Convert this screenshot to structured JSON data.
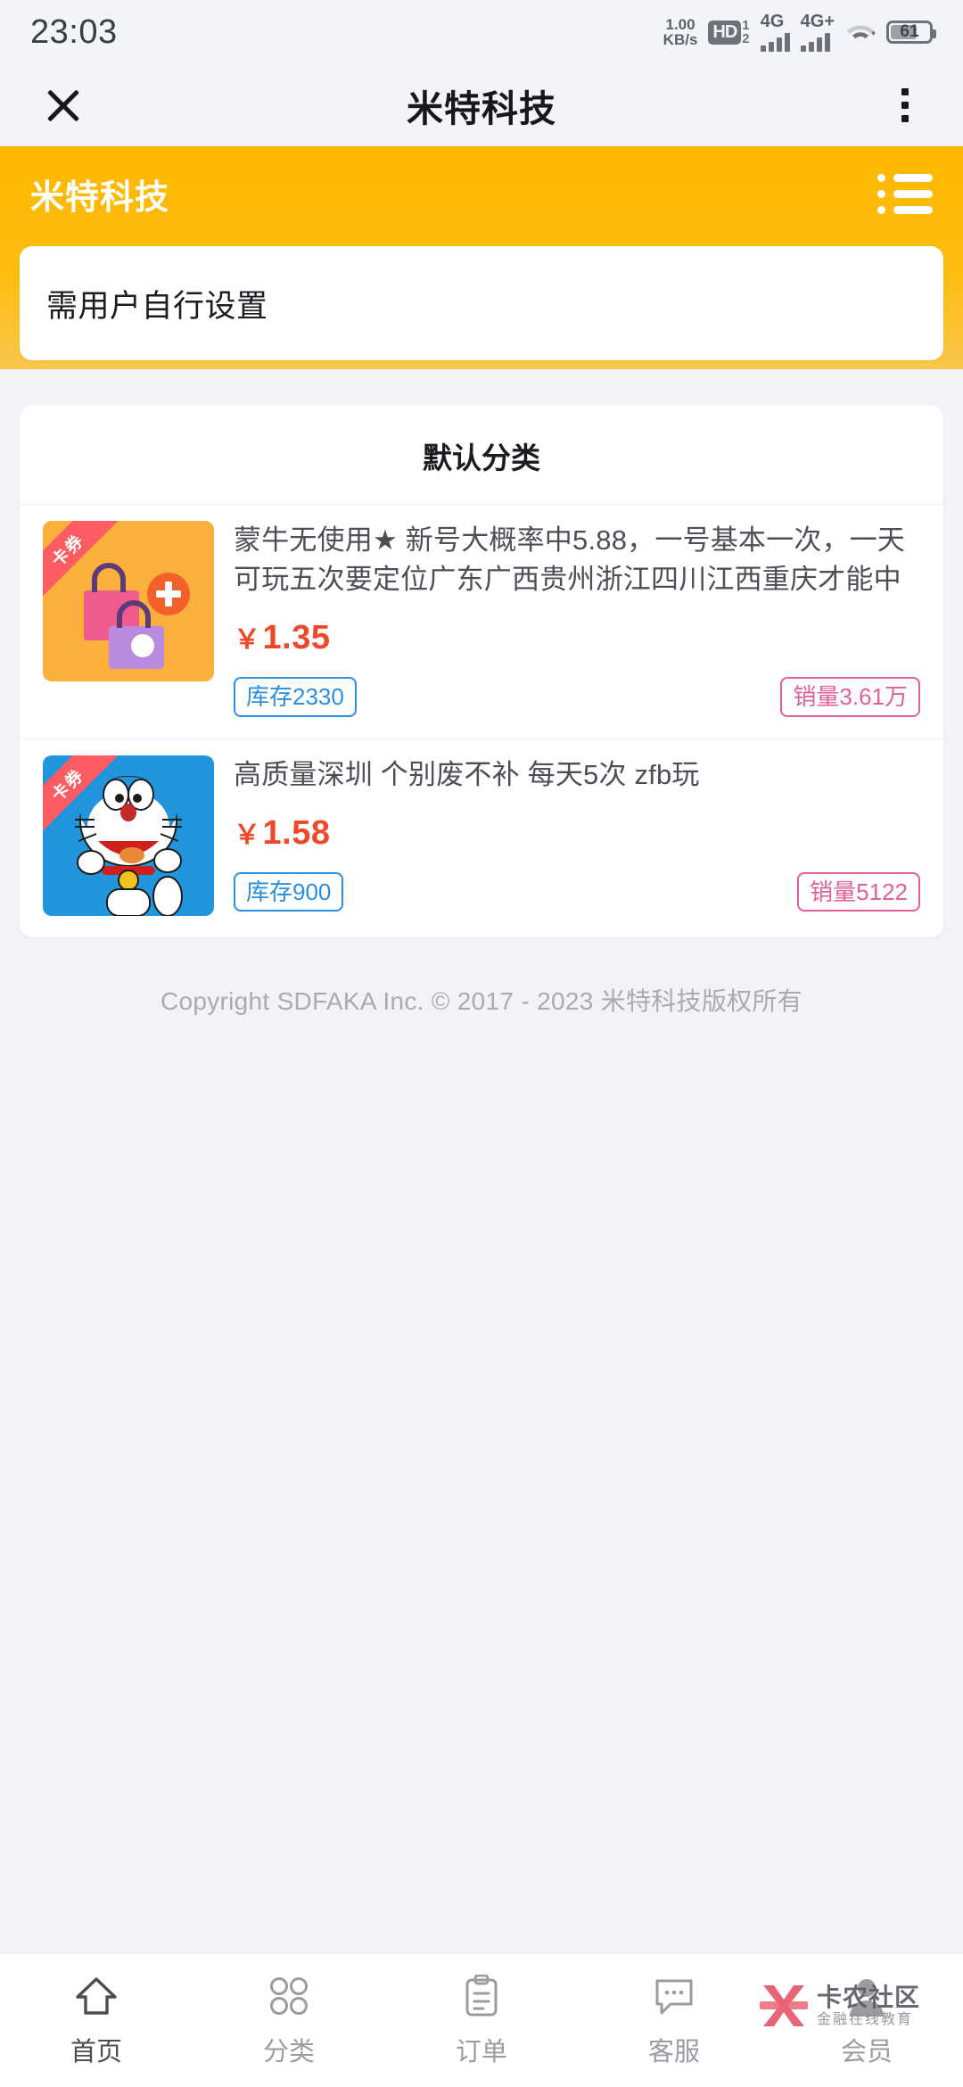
{
  "status_bar": {
    "time": "23:03",
    "network_speed_value": "1.00",
    "network_speed_unit": "KB/s",
    "hd_label": "HD",
    "sim1_label": "1",
    "sim2_label": "2",
    "signal1_label": "4G",
    "signal2_label": "4G+",
    "battery_level": "61",
    "wifi_icon": "wifi-icon"
  },
  "nav_bar": {
    "close_icon": "close-icon",
    "title": "米特科技",
    "more_icon": "overflow-menu-icon"
  },
  "shop_header": {
    "shop_name": "米特科技",
    "menu_icon": "list-menu-icon",
    "accent_color": "#ffb800"
  },
  "notice": {
    "text": "需用户自行设置"
  },
  "category": {
    "title": "默认分类",
    "products": [
      {
        "ribbon": "卡券",
        "name": "蒙牛无使用★ 新号大概率中5.88，一号基本一次，一天可玩五次要定位广东广西贵州浙江四川江西重庆才能中",
        "currency": "￥",
        "price": "1.35",
        "stock_badge": "库存2330",
        "sales_badge": "销量3.61万",
        "thumb": "shopping-bag-image"
      },
      {
        "ribbon": "卡券",
        "name": "高质量深圳 个别废不补 每天5次 zfb玩",
        "currency": "￥",
        "price": "1.58",
        "stock_badge": "库存900",
        "sales_badge": "销量5122",
        "thumb": "doraemon-image"
      }
    ]
  },
  "footer": {
    "copyright": "Copyright SDFAKA Inc. © 2017 - 2023 米特科技版权所有"
  },
  "tabbar": {
    "items": [
      {
        "label": "首页",
        "icon": "home-icon",
        "active": true
      },
      {
        "label": "分类",
        "icon": "grid-icon",
        "active": false
      },
      {
        "label": "订单",
        "icon": "clipboard-icon",
        "active": false
      },
      {
        "label": "客服",
        "icon": "chat-icon",
        "active": false
      },
      {
        "label": "会员",
        "icon": "user-icon",
        "active": false
      }
    ]
  },
  "watermark": {
    "main": "卡农社区",
    "sub": "金融在线教育",
    "color": "#e8596b"
  },
  "colors": {
    "price": "#f0482a",
    "stock": "#2a8fe0",
    "sales": "#e0609c",
    "page_bg": "#f2f3f7"
  }
}
